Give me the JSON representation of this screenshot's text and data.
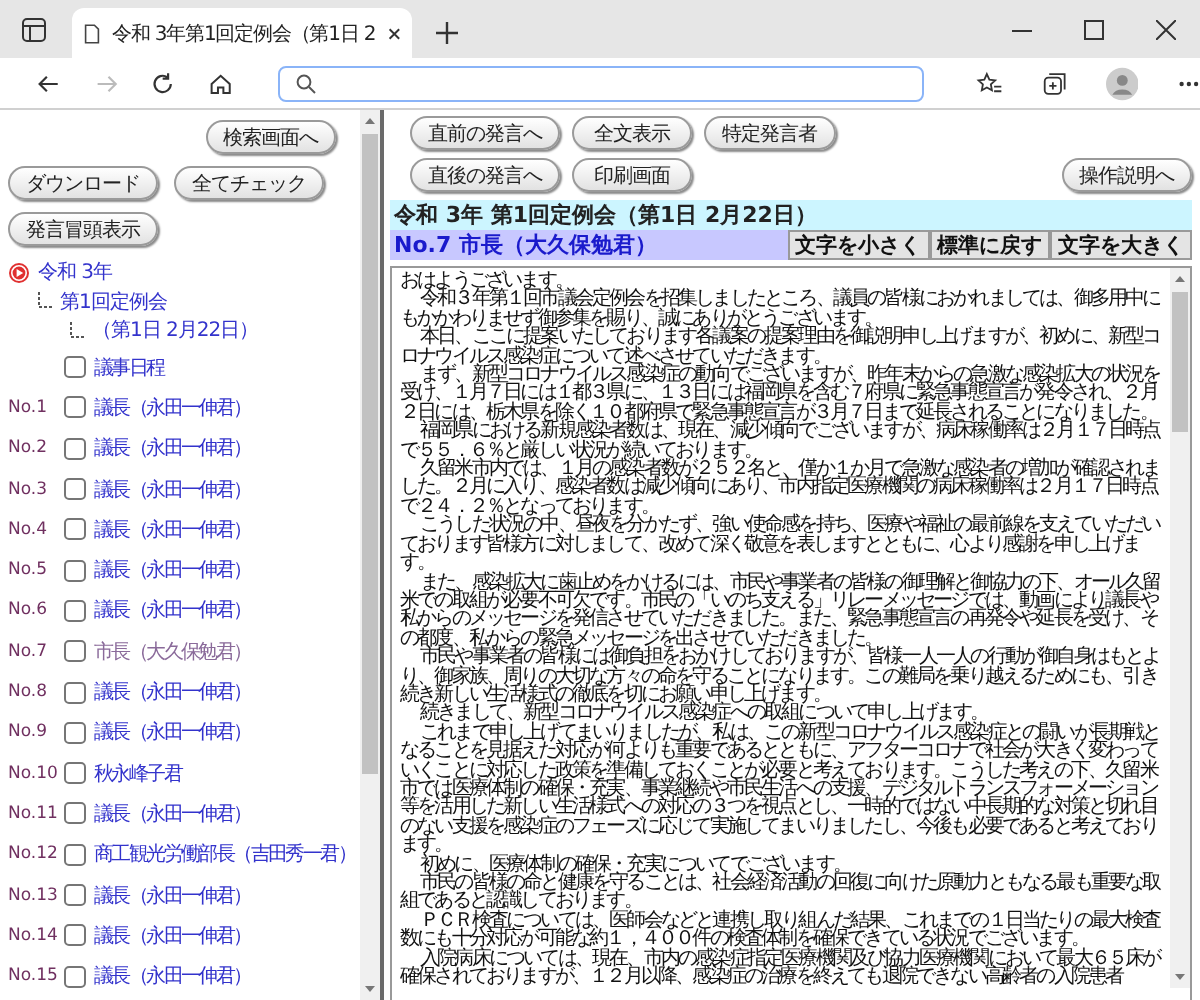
{
  "browser": {
    "tab_title": "令和 3年第1回定例会（第1日 2"
  },
  "sidebar": {
    "button_rows": [
      [
        "検索画面へ"
      ],
      [
        "ダウンロード",
        "全てチェック"
      ],
      [
        "発言冒頭表示"
      ]
    ],
    "tree": [
      {
        "label": "令和 3年",
        "children": [
          {
            "label": "第1回定例会",
            "children": [
              {
                "label": "（第1日 2月22日）"
              }
            ]
          }
        ]
      }
    ],
    "speeches": [
      {
        "label": "議事日程",
        "checked": false,
        "selected": false
      },
      {
        "number": "No.1",
        "label": "議長（永田一伸君）",
        "checked": false,
        "selected": false
      },
      {
        "number": "No.2",
        "label": "議長（永田一伸君）",
        "checked": false,
        "selected": false
      },
      {
        "number": "No.3",
        "label": "議長（永田一伸君）",
        "checked": false,
        "selected": false
      },
      {
        "number": "No.4",
        "label": "議長（永田一伸君）",
        "checked": false,
        "selected": false
      },
      {
        "number": "No.5",
        "label": "議長（永田一伸君）",
        "checked": false,
        "selected": false
      },
      {
        "number": "No.6",
        "label": "議長（永田一伸君）",
        "checked": false,
        "selected": false
      },
      {
        "number": "No.7",
        "label": "市長（大久保勉君）",
        "checked": false,
        "selected": true
      },
      {
        "number": "No.8",
        "label": "議長（永田一伸君）",
        "checked": false,
        "selected": false
      },
      {
        "number": "No.9",
        "label": "議長（永田一伸君）",
        "checked": false,
        "selected": false
      },
      {
        "number": "No.10",
        "label": "秋永峰子君",
        "checked": false,
        "selected": false
      },
      {
        "number": "No.11",
        "label": "議長（永田一伸君）",
        "checked": false,
        "selected": false
      },
      {
        "number": "No.12",
        "label": "商工観光労働部長（吉田秀一君）",
        "checked": false,
        "selected": false
      },
      {
        "number": "No.13",
        "label": "議長（永田一伸君）",
        "checked": false,
        "selected": false
      },
      {
        "number": "No.14",
        "label": "議長（永田一伸君）",
        "checked": false,
        "selected": false
      },
      {
        "number": "No.15",
        "label": "議長（永田一伸君）",
        "checked": false,
        "selected": false
      }
    ]
  },
  "main": {
    "button_rows": [
      [
        "直前の発言へ",
        "全文表示",
        "特定発言者"
      ],
      [
        "直後の発言へ",
        "印刷画面"
      ]
    ],
    "help_button": "操作説明へ",
    "session_title": "令和 3年 第1回定例会（第1日 2月22日）",
    "speaker": "No.7 市長（大久保勉君）",
    "font_buttons": [
      "文字を小さく",
      "標準に戻す",
      "文字を大きく"
    ],
    "paragraphs": [
      "おはようございます。",
      "令和３年第１回市議会定例会を招集しましたところ、議員の皆様におかれましては、御多用中にもかかわりませず御参集を賜り、誠にありがとうございます。",
      "本日、ここに提案いたしております各議案の提案理由を御説明申し上げますが、初めに、新型コロナウイルス感染症について述べさせていただきます。",
      "まず、新型コロナウイルス感染症の動向でございますが、昨年末からの急激な感染拡大の状況を受け、１月７日には１都３県に、１３日には福岡県を含む７府県に緊急事態宣言が発令され、２月２日には、栃木県を除く１０都府県で緊急事態宣言が３月７日まで延長されることになりました。",
      "福岡県における新規感染者数は、現在、減少傾向でございますが、病床稼働率は２月１７日時点で５５．６％と厳しい状況が続いております。",
      "久留米市内では、１月の感染者数が２５２名と、僅か１か月で急激な感染者の増加が確認されました。２月に入り、感染者数は減少傾向にあり、市内指定医療機関の病床稼働率は２月１７日時点で２４．２％となっております。",
      "こうした状況の中、昼夜を分かたず、強い使命感を持ち、医療や福祉の最前線を支えていただいております皆様方に対しまして、改めて深く敬意を表しますとともに、心より感謝を申し上げます。",
      "また、感染拡大に歯止めをかけるには、市民や事業者の皆様の御理解と御協力の下、オール久留米での取組が必要不可欠です。市民の「いのち支える」リレーメッセージでは、動画により議長や私からのメッセージを発信させていただきました。また、緊急事態宣言の再発令や延長を受け、その都度、私からの緊急メッセージを出させていただきました。",
      "市民や事業者の皆様には御負担をおかけしておりますが、皆様一人一人の行動が御自身はもとより、御家族、周りの大切な方々の命を守ることになります。この難局を乗り越えるためにも、引き続き新しい生活様式の徹底を切にお願い申し上げます。",
      "続きまして、新型コロナウイルス感染症への取組について申し上げます。",
      "これまで申し上げてまいりましたが、私は、この新型コロナウイルス感染症との闘いが長期戦となることを見据えた対応が何よりも重要であるとともに、アフターコロナで社会が大きく変わっていくことに対応した政策を準備しておくことが必要と考えております。こうした考えの下、久留米市では医療体制の確保・充実、事業継続や市民生活への支援、デジタルトランスフォーメーション等を活用した新しい生活様式への対応の３つを視点とし、一時的ではない中長期的な対策と切れ目のない支援を感染症のフェーズに応じて実施してまいりましたし、今後も必要であると考えております。",
      "初めに、医療体制の確保・充実についてでございます。",
      "市民の皆様の命と健康を守ることは、社会経済活動の回復に向けた原動力ともなる最も重要な取組であると認識しております。",
      "ＰＣＲ検査については、医師会などと連携し取り組んだ結果、これまでの１日当たりの最大検査数にも十分対応が可能な約１，４００件の検査体制を確保できている状況でございます。",
      "入院病床については、現在、市内の感染症指定医療機関及び協力医療機関において最大６５床が確保されておりますが、１２月以降、感染症の治療を終えても退院できない高齢者の入院患者"
    ]
  }
}
